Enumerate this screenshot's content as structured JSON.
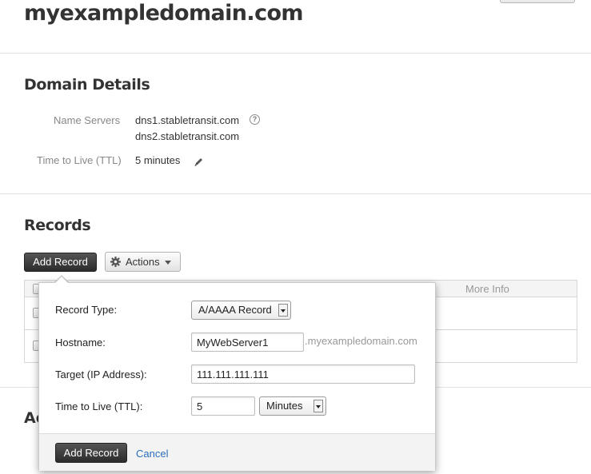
{
  "page": {
    "title": "myexampledomain.com"
  },
  "domain_details": {
    "heading": "Domain Details",
    "name_servers_label": "Name Servers",
    "name_servers": [
      "dns1.stabletransit.com",
      "dns2.stabletransit.com"
    ],
    "ttl_label": "Time to Live (TTL)",
    "ttl_value": "5 minutes"
  },
  "records": {
    "heading": "Records",
    "add_record_label": "Add Record",
    "actions_label": "Actions",
    "table": {
      "columns": [
        "More Info"
      ]
    }
  },
  "bottom_section": {
    "heading_partial": "Ac"
  },
  "add_record_form": {
    "record_type_label": "Record Type:",
    "record_type_value": "A/AAAA Record",
    "hostname_label": "Hostname:",
    "hostname_value": "MyWebServer1",
    "hostname_suffix": ".myexampledomain.com",
    "target_label": "Target (IP Address):",
    "target_value": "111.111.111.111",
    "ttl_label": "Time to Live (TTL):",
    "ttl_value": "5",
    "ttl_unit": "Minutes",
    "submit_label": "Add Record",
    "cancel_label": "Cancel"
  },
  "colors": {
    "link": "#2a6ebb",
    "primary_button": "#333333"
  }
}
